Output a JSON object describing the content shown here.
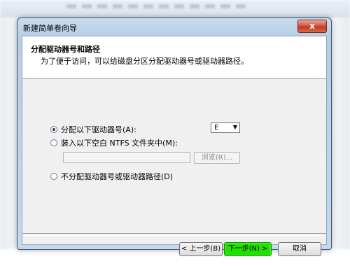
{
  "window": {
    "title": "新建简单卷向导",
    "close_label": "x"
  },
  "header": {
    "title": "分配驱动器号和路径",
    "subtitle": "为了便于访问，可以给磁盘分区分配驱动器号或驱动器路径。"
  },
  "options": {
    "assign_letter_label": "分配以下驱动器号(A):",
    "mount_folder_label": "装入以下空白 NTFS 文件夹中(M):",
    "no_assign_label": "不分配驱动器号或驱动器路径(D)",
    "selected": "assign_letter"
  },
  "drive_letter": {
    "value": "E"
  },
  "folder_path": {
    "value": "",
    "browse_label": "浏览(R)..."
  },
  "buttons": {
    "back_label": "< 上一步(B)",
    "next_label": "下一步(N) >",
    "cancel_label": "取消"
  },
  "colors": {
    "next_highlight": "#22e000"
  }
}
